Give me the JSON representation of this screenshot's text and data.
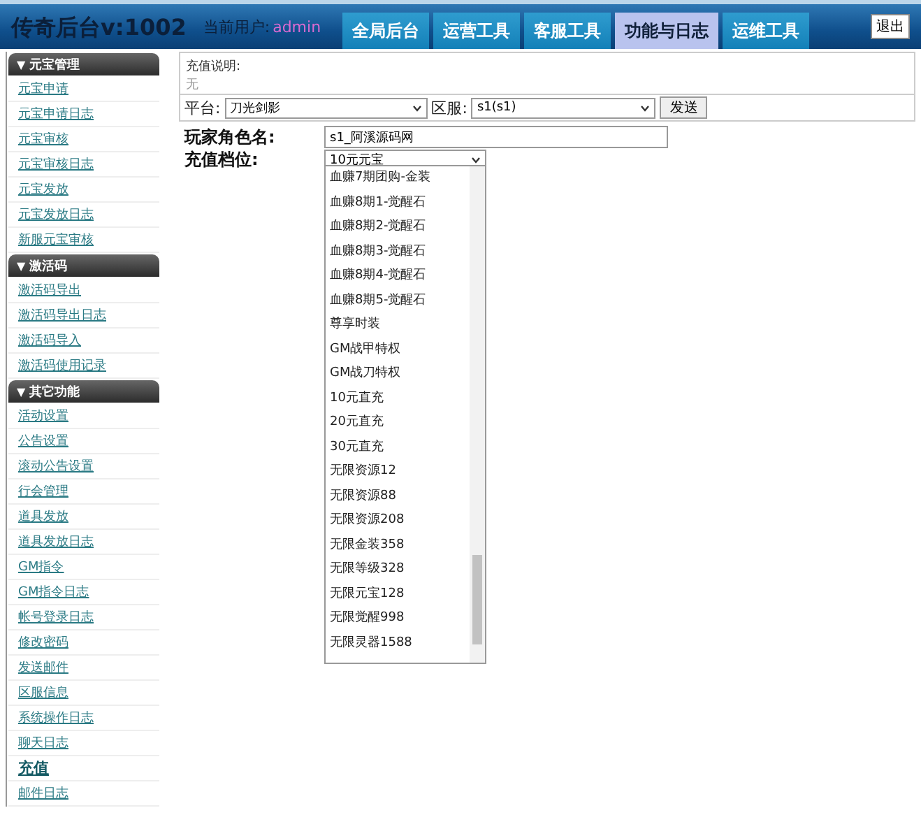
{
  "header": {
    "title": "传奇后台v:1002",
    "user_label": "当前用户:",
    "user_name": "admin",
    "logout": "退出"
  },
  "tabs": [
    {
      "label": "全局后台",
      "selected": false
    },
    {
      "label": "运营工具",
      "selected": false
    },
    {
      "label": "客服工具",
      "selected": false
    },
    {
      "label": "功能与日志",
      "selected": true
    },
    {
      "label": "运维工具",
      "selected": false
    }
  ],
  "sidebar": [
    {
      "icon": "▼",
      "title": "元宝管理",
      "items": [
        {
          "label": "元宝申请",
          "selected": false
        },
        {
          "label": "元宝申请日志",
          "selected": false
        },
        {
          "label": "元宝审核",
          "selected": false
        },
        {
          "label": "元宝审核日志",
          "selected": false
        },
        {
          "label": "元宝发放",
          "selected": false
        },
        {
          "label": "元宝发放日志",
          "selected": false
        },
        {
          "label": "新服元宝审核",
          "selected": false
        }
      ]
    },
    {
      "icon": "▼",
      "title": "激活码",
      "items": [
        {
          "label": "激活码导出",
          "selected": false
        },
        {
          "label": "激活码导出日志",
          "selected": false
        },
        {
          "label": "激活码导入",
          "selected": false
        },
        {
          "label": "激活码使用记录",
          "selected": false
        }
      ]
    },
    {
      "icon": "▼",
      "title": "其它功能",
      "items": [
        {
          "label": "活动设置",
          "selected": false
        },
        {
          "label": "公告设置",
          "selected": false
        },
        {
          "label": "滚动公告设置",
          "selected": false
        },
        {
          "label": "行会管理",
          "selected": false
        },
        {
          "label": "道具发放",
          "selected": false
        },
        {
          "label": "道具发放日志",
          "selected": false
        },
        {
          "label": "GM指令",
          "selected": false
        },
        {
          "label": "GM指令日志",
          "selected": false
        },
        {
          "label": "帐号登录日志",
          "selected": false
        },
        {
          "label": "修改密码",
          "selected": false
        },
        {
          "label": "发送邮件",
          "selected": false
        },
        {
          "label": "区服信息",
          "selected": false
        },
        {
          "label": "系统操作日志",
          "selected": false
        },
        {
          "label": "聊天日志",
          "selected": false
        },
        {
          "label": "充值",
          "selected": true
        },
        {
          "label": "邮件日志",
          "selected": false
        }
      ]
    }
  ],
  "form": {
    "note_label": "充值说明:",
    "note_value": "无",
    "platform_label": "平台:",
    "platform_value": "刀光剑影",
    "server_label": "区服:",
    "server_value": "s1(s1)",
    "send_button": "发送",
    "player_label": "玩家角色名:",
    "player_value": "s1_阿溪源码网",
    "tier_label": "充值档位:",
    "tier_value": "10元元宝",
    "tier_options": [
      "血赚7期团购-金装",
      "血赚8期1-觉醒石",
      "血赚8期2-觉醒石",
      "血赚8期3-觉醒石",
      "血赚8期4-觉醒石",
      "血赚8期5-觉醒石",
      "尊享时装",
      "GM战甲特权",
      "GM战刀特权",
      "10元直充",
      "20元直充",
      "30元直充",
      "无限资源12",
      "无限资源88",
      "无限资源208",
      "无限金装358",
      "无限等级328",
      "无限元宝128",
      "无限觉醒998",
      "无限灵器1588"
    ]
  }
}
